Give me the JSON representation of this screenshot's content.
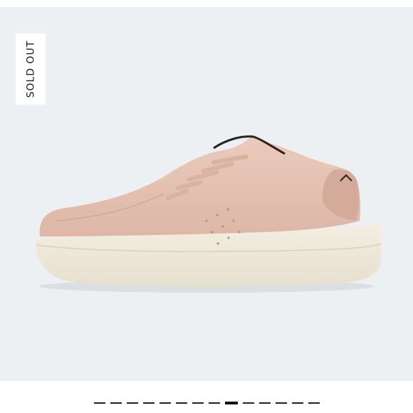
{
  "badge": {
    "label": "SOLD OUT"
  },
  "product": {
    "image_icon": "sneaker-image",
    "colors": {
      "upper": "#e4c2b4",
      "sole": "#f1ebde",
      "background": "#edf0f2"
    }
  },
  "carousel": {
    "total": 14,
    "active_index": 8
  }
}
